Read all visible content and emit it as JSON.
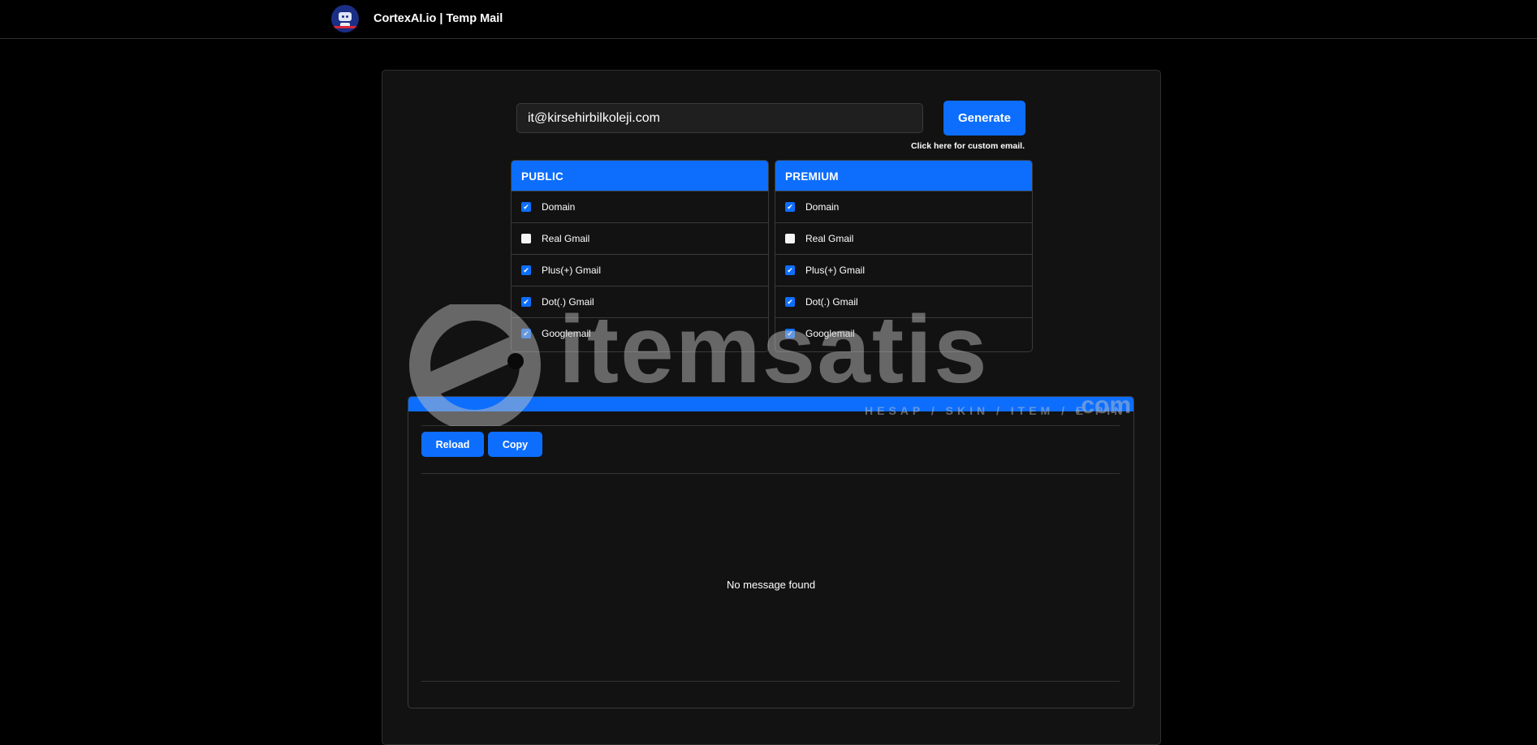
{
  "navbar": {
    "brand": "CortexAI.io | Temp Mail",
    "logo": "robot-logo"
  },
  "generator": {
    "email": "it@kirsehirbilkoleji.com",
    "generate_label": "Generate",
    "custom_link": "Click here for custom email."
  },
  "public": {
    "title": "PUBLIC",
    "options": [
      {
        "label": "Domain",
        "checked": true
      },
      {
        "label": "Real Gmail",
        "checked": false
      },
      {
        "label": "Plus(+) Gmail",
        "checked": true
      },
      {
        "label": "Dot(.) Gmail",
        "checked": true
      },
      {
        "label": "Googlemail",
        "checked": true
      }
    ]
  },
  "premium": {
    "title": "PREMIUM",
    "options": [
      {
        "label": "Domain",
        "checked": true
      },
      {
        "label": "Real Gmail",
        "checked": false
      },
      {
        "label": "Plus(+) Gmail",
        "checked": true
      },
      {
        "label": "Dot(.) Gmail",
        "checked": true
      },
      {
        "label": "Googlemail",
        "checked": true
      }
    ]
  },
  "inbox": {
    "reload_label": "Reload",
    "copy_label": "Copy",
    "empty_message": "No message found"
  },
  "watermark": {
    "word": "itemsatis",
    "tagline": "HESAP / SKIN / ITEM / E-PIN",
    "suffix": ".com"
  },
  "colors": {
    "accent": "#0d6efd",
    "background": "#000000",
    "card": "#121212"
  }
}
